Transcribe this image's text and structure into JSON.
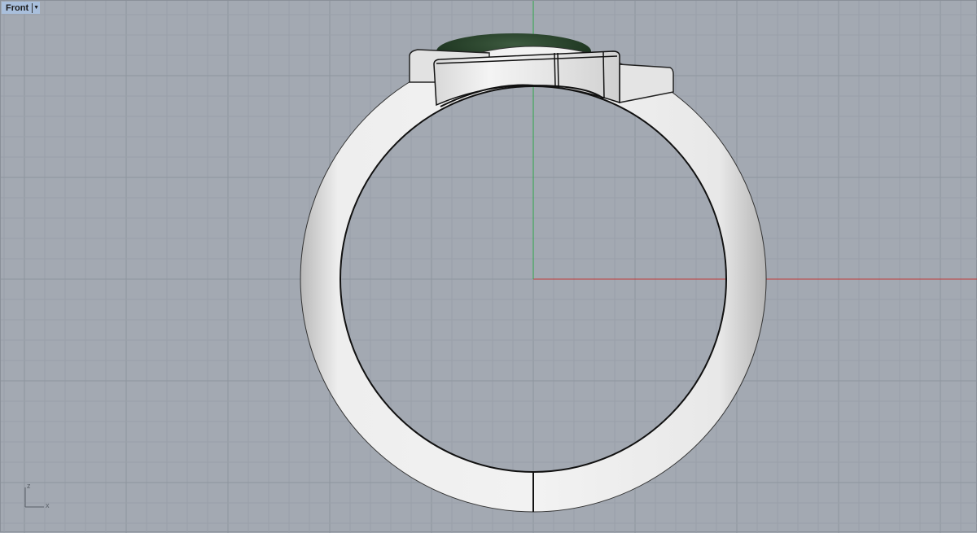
{
  "viewport": {
    "name": "Front",
    "menu_icon": "dropdown-arrow-icon"
  },
  "axes_widget": {
    "z_label": "z",
    "x_label": "x"
  },
  "colors": {
    "background": "#a3a9b2",
    "grid_minor": "#99a0a9",
    "grid_major": "#8e959e",
    "x_axis": "#c23a3a",
    "z_axis": "#2fa84a",
    "gem": "#1f3a22"
  }
}
